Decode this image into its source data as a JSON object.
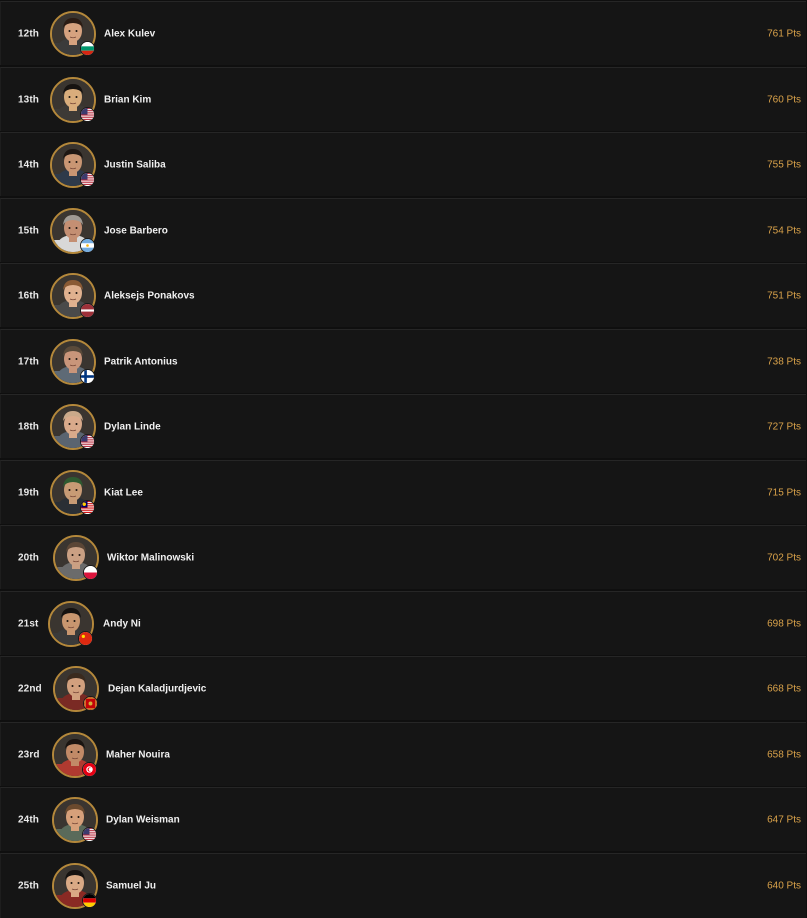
{
  "leaderboard": {
    "rows": [
      {
        "rank": "12th",
        "name": "Alex Kulev",
        "points": "761 Pts",
        "flag": "bulgaria-flag-icon",
        "skin": "#d6a27f",
        "hair": "#2b1c14",
        "shirt": "#3b3b3b"
      },
      {
        "rank": "13th",
        "name": "Brian Kim",
        "points": "760 Pts",
        "flag": "usa-flag-icon",
        "skin": "#d9ad7c",
        "hair": "#171311",
        "shirt": "#3d3a36"
      },
      {
        "rank": "14th",
        "name": "Justin Saliba",
        "points": "755 Pts",
        "flag": "usa-flag-icon",
        "skin": "#c99673",
        "hair": "#1e1713",
        "shirt": "#2e3a4a"
      },
      {
        "rank": "15th",
        "name": "Jose Barbero",
        "points": "754 Pts",
        "flag": "argentina-flag-icon",
        "skin": "#c48f73",
        "hair": "#a09a94",
        "shirt": "#d8d8d8"
      },
      {
        "rank": "16th",
        "name": "Aleksejs Ponakovs",
        "points": "751 Pts",
        "flag": "latvia-flag-icon",
        "skin": "#e0b18f",
        "hair": "#8a5a34",
        "shirt": "#4a4a4a"
      },
      {
        "rank": "17th",
        "name": "Patrik Antonius",
        "points": "738 Pts",
        "flag": "finland-flag-icon",
        "skin": "#c9957a",
        "hair": "#5a4a3a",
        "shirt": "#5e6a76"
      },
      {
        "rank": "18th",
        "name": "Dylan Linde",
        "points": "727 Pts",
        "flag": "usa-flag-icon",
        "skin": "#d9aa8b",
        "hair": "#caa98a",
        "shirt": "#5a6470"
      },
      {
        "rank": "19th",
        "name": "Kiat Lee",
        "points": "715 Pts",
        "flag": "malaysia-flag-icon",
        "skin": "#c89b75",
        "hair": "#2f5a30",
        "shirt": "#2a2f35"
      },
      {
        "rank": "20th",
        "name": "Wiktor Malinowski",
        "points": "702 Pts",
        "flag": "poland-flag-icon",
        "skin": "#caa083",
        "hair": "#5b4636",
        "shirt": "#6b6b6b"
      },
      {
        "rank": "21st",
        "name": "Andy Ni",
        "points": "698 Pts",
        "flag": "china-flag-icon",
        "skin": "#c8966f",
        "hair": "#151210",
        "shirt": "#3a3a3a"
      },
      {
        "rank": "22nd",
        "name": "Dejan Kaladjurdjevic",
        "points": "668 Pts",
        "flag": "montenegro-flag-icon",
        "skin": "#d1a07e",
        "hair": "#3a2a1e",
        "shirt": "#7a2a24"
      },
      {
        "rank": "23rd",
        "name": "Maher Nouira",
        "points": "658 Pts",
        "flag": "tunisia-flag-icon",
        "skin": "#c28a67",
        "hair": "#1a1411",
        "shirt": "#b03a30"
      },
      {
        "rank": "24th",
        "name": "Dylan Weisman",
        "points": "647 Pts",
        "flag": "usa-flag-icon",
        "skin": "#d6a07a",
        "hair": "#6b4a2e",
        "shirt": "#5a6a5a"
      },
      {
        "rank": "25th",
        "name": "Samuel Ju",
        "points": "640 Pts",
        "flag": "germany-flag-icon",
        "skin": "#d9a985",
        "hair": "#151210",
        "shirt": "#8a2a24"
      }
    ]
  }
}
